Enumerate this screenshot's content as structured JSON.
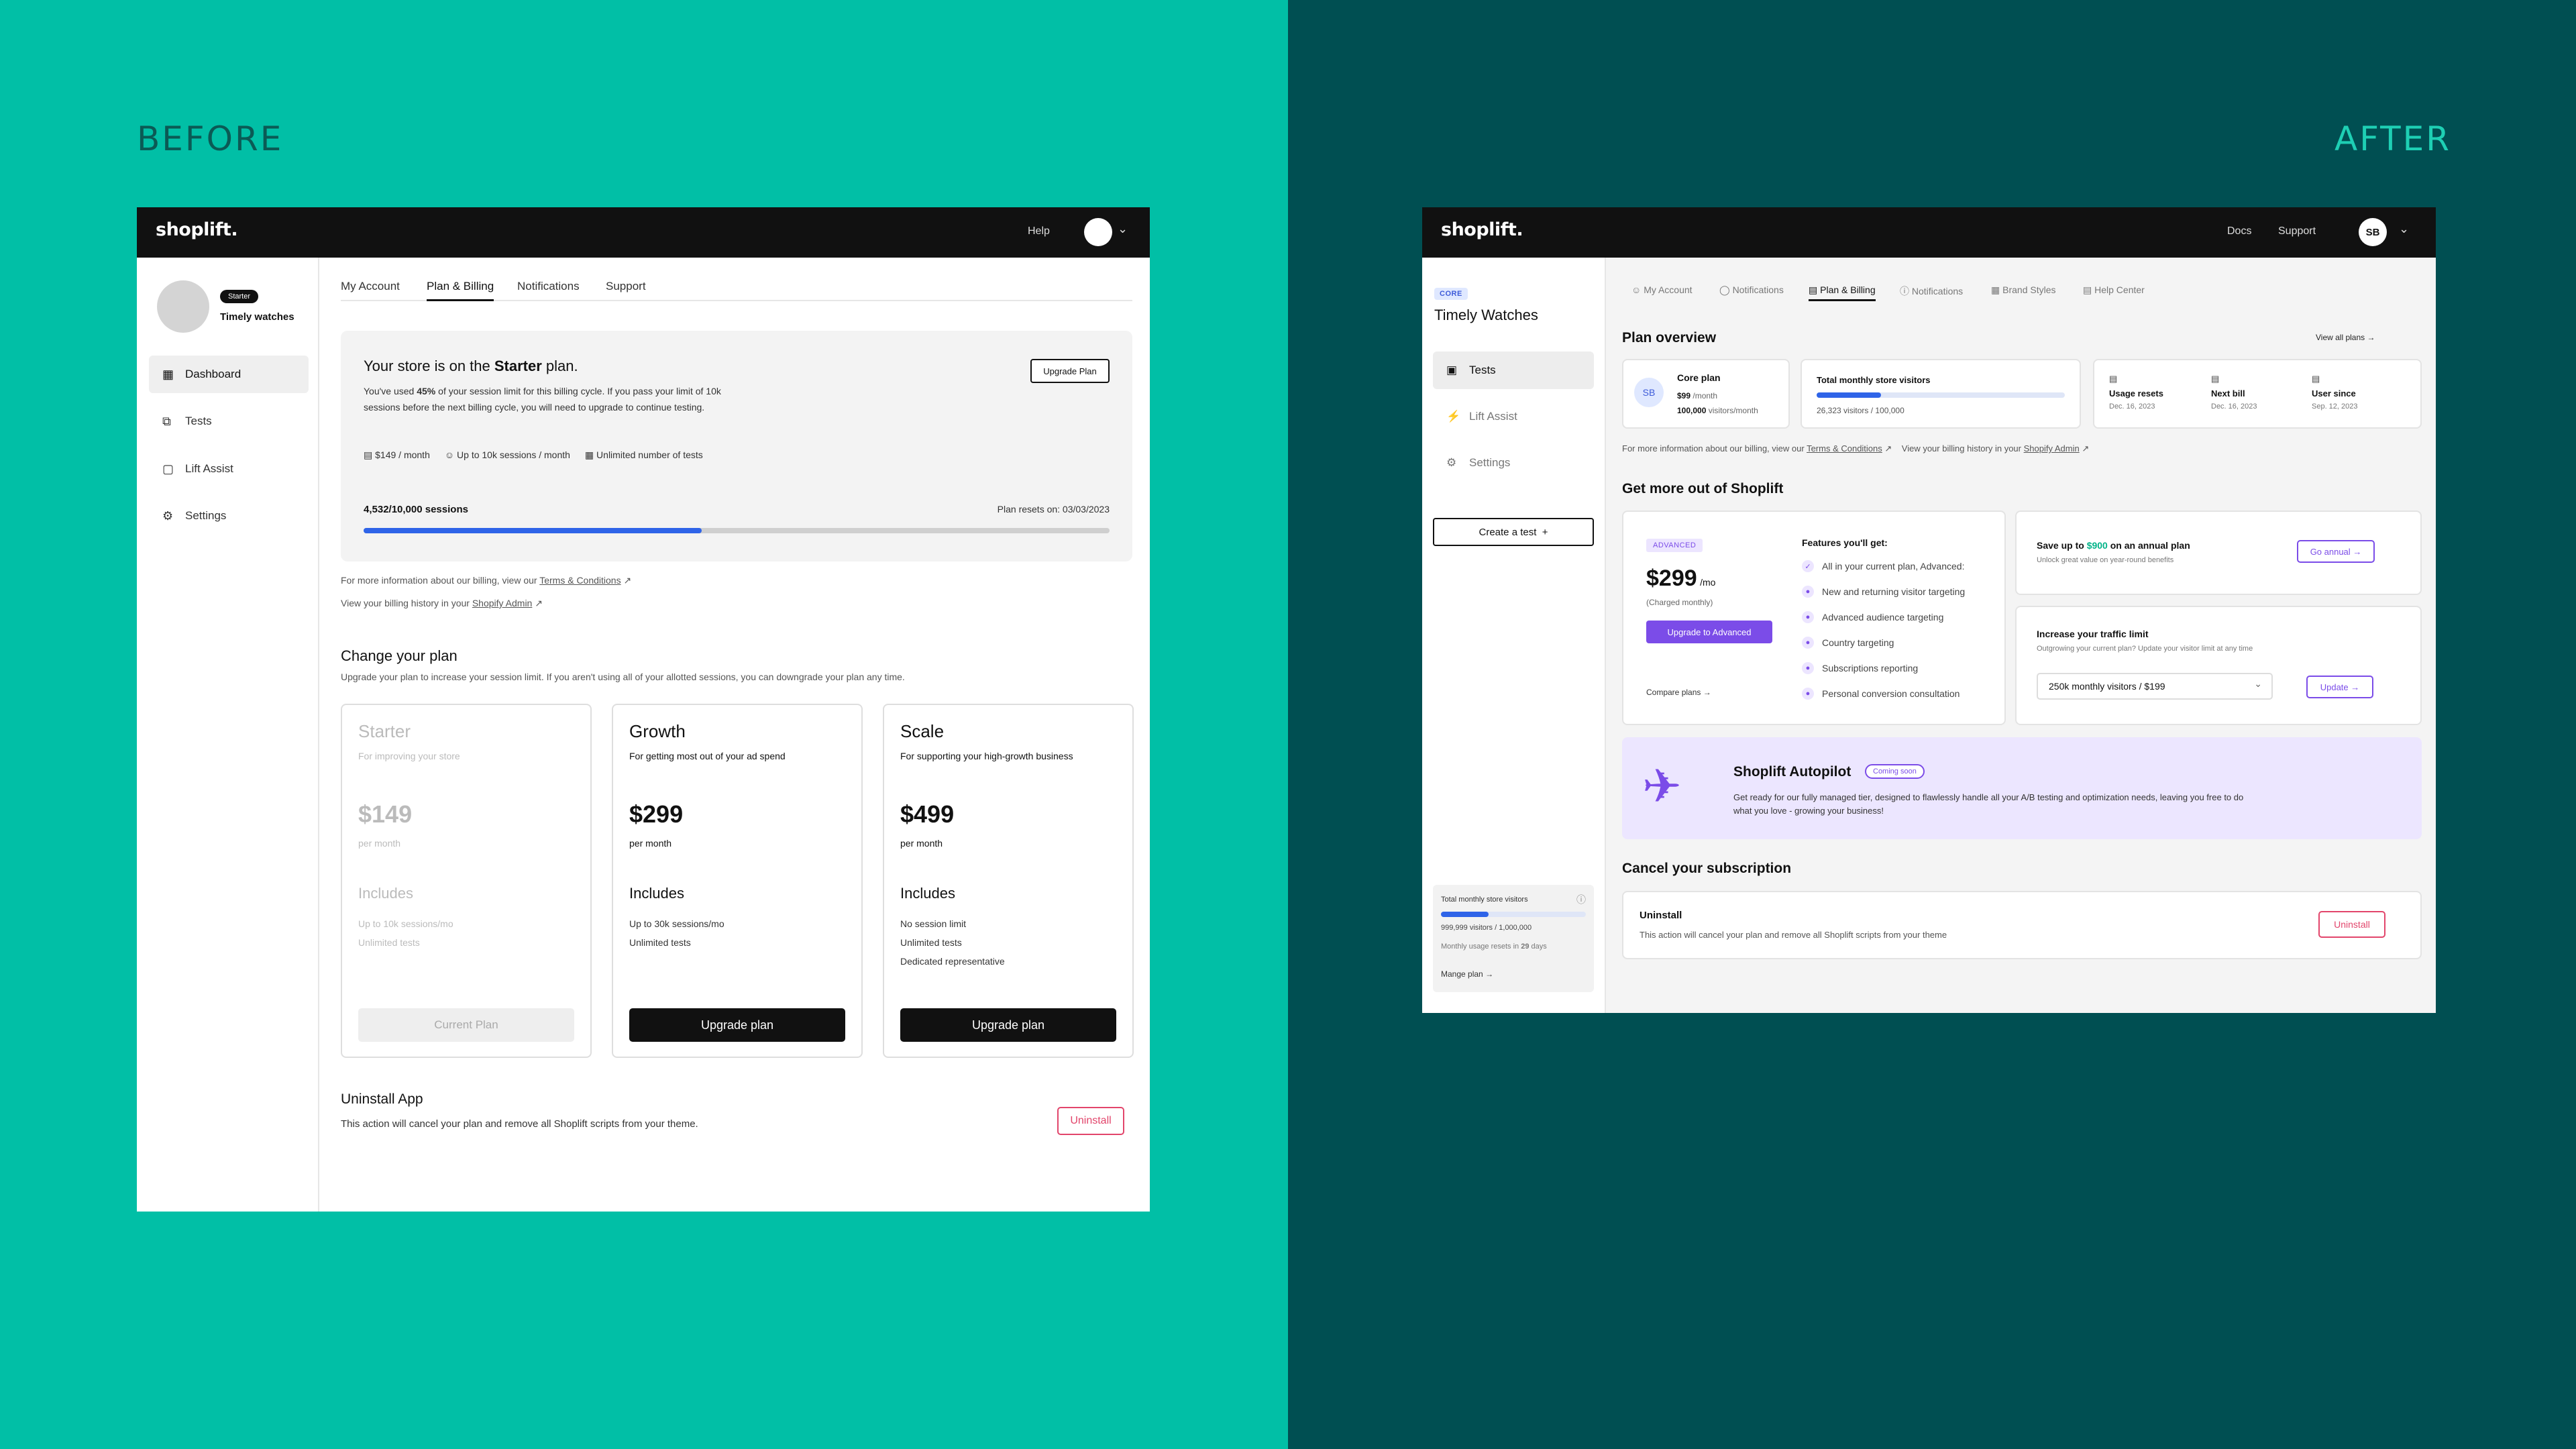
{
  "labels": {
    "before": "BEFORE",
    "after": "AFTER"
  },
  "colors": {
    "teal": "#01bfa6",
    "dark_teal": "#004f52",
    "purple": "#7b4ce8",
    "blue": "#2f64e8",
    "pink": "#e2456b"
  },
  "before": {
    "logo": "shoplift.",
    "top_help": "Help",
    "sidebar": {
      "badge": "Starter",
      "store_name": "Timely watches",
      "items": [
        {
          "label": "Dashboard",
          "icon": "dashboard-icon"
        },
        {
          "label": "Tests",
          "icon": "tests-icon"
        },
        {
          "label": "Lift Assist",
          "icon": "briefcase-icon"
        },
        {
          "label": "Settings",
          "icon": "gear-icon"
        }
      ]
    },
    "tabs": [
      "My Account",
      "Plan & Billing",
      "Notifications",
      "Support"
    ],
    "plan_box": {
      "title_pre": "Your store is on the ",
      "title_plan": "Starter",
      "title_post": " plan.",
      "desc_pre": "You've used ",
      "desc_pct": "45%",
      "desc_post": " of your session limit for this billing cycle. If you pass your limit of 10k sessions before the next billing cycle, you will need to upgrade to continue testing.",
      "upgrade_button": "Upgrade Plan",
      "meta": [
        "$149 / month",
        "Up to 10k sessions / month",
        "Unlimited number of tests"
      ],
      "sessions": "4,532/10,000 sessions",
      "resets": "Plan resets on: 03/03/2023",
      "progress": 0.4532
    },
    "billing_info_pre": "For more information about our billing, view our ",
    "billing_info_link": "Terms & Conditions",
    "billing_history_pre": "View your billing history in your ",
    "billing_history_link": "Shopify Admin",
    "change_plan": {
      "title": "Change your plan",
      "subtitle": "Upgrade your plan to increase your session limit. If you aren't using all of your allotted sessions, you can downgrade your plan any time.",
      "plans": [
        {
          "name": "Starter",
          "desc": "For improving your store",
          "price": "$149",
          "per": "per month",
          "includes": "Includes",
          "features": [
            "Up to 10k sessions/mo",
            "Unlimited tests"
          ],
          "button": "Current Plan"
        },
        {
          "name": "Growth",
          "desc": "For getting most out of your ad spend",
          "price": "$299",
          "per": "per month",
          "includes": "Includes",
          "features": [
            "Up to 30k sessions/mo",
            "Unlimited tests"
          ],
          "button": "Upgrade plan"
        },
        {
          "name": "Scale",
          "desc": "For supporting your high-growth business",
          "price": "$499",
          "per": "per month",
          "includes": "Includes",
          "features": [
            "No session limit",
            "Unlimited tests",
            "Dedicated representative"
          ],
          "button": "Upgrade plan"
        }
      ]
    },
    "uninstall": {
      "title": "Uninstall App",
      "desc": "This action will cancel your plan and remove all Shoplift scripts from your theme.",
      "button": "Uninstall"
    }
  },
  "after": {
    "logo": "shoplift.",
    "top_docs": "Docs",
    "top_support": "Support",
    "avatar": "SB",
    "sidebar": {
      "badge": "CORE",
      "store_name": "Timely Watches",
      "items": [
        {
          "label": "Tests",
          "icon": "tests-icon"
        },
        {
          "label": "Lift Assist",
          "icon": "bolt-icon"
        },
        {
          "label": "Settings",
          "icon": "gear-icon"
        }
      ],
      "create_button": "Create a test",
      "usage": {
        "title": "Total monthly store visitors",
        "value": "999,999 visitors / 1,000,000",
        "resets_pre": "Monthly usage resets in ",
        "resets_days": "29",
        "resets_post": " days",
        "link": "Mange plan",
        "progress": 0.33
      }
    },
    "tabs": [
      "My Account",
      "Notifications",
      "Plan & Billing",
      "Notifications",
      "Brand Styles",
      "Help Center"
    ],
    "plan_overview": {
      "title": "Plan overview",
      "view_all": "View all plans",
      "plan_avatar": "SB",
      "plan_name": "Core plan",
      "plan_price": "$99",
      "plan_price_unit": "/month",
      "plan_visitors": "100,000",
      "plan_visitors_unit": "visitors/month",
      "visitors_title": "Total monthly store visitors",
      "visitors_value": "26,323 visitors / 100,000",
      "visitors_progress": 0.26,
      "stats": [
        {
          "label": "Usage resets",
          "value": "Dec. 16, 2023"
        },
        {
          "label": "Next bill",
          "value": "Dec. 16, 2023"
        },
        {
          "label": "User since",
          "value": "Sep. 12, 2023"
        }
      ],
      "billing_info_pre": "For more information about our billing, view our ",
      "billing_info_link": "Terms & Conditions",
      "billing_history_pre": "View your billing history in your ",
      "billing_history_link": "Shopify Admin"
    },
    "get_more": {
      "title": "Get more out of Shoplift",
      "badge": "ADVANCED",
      "price": "$299",
      "price_unit": "/mo",
      "charged": "(Charged monthly)",
      "upgrade_button": "Upgrade to Advanced",
      "compare": "Compare plans",
      "features_title": "Features you'll get:",
      "features": [
        "All in your current plan, Advanced:",
        "New and returning visitor targeting",
        "Advanced audience targeting",
        "Country targeting",
        "Subscriptions reporting",
        "Personal conversion consultation"
      ],
      "annual": {
        "title_pre": "Save up to ",
        "title_amount": "$900",
        "title_post": " on an annual plan",
        "desc": "Unlock great value on year-round benefits",
        "button": "Go annual"
      },
      "traffic": {
        "title": "Increase your traffic limit",
        "desc": "Outgrowing your current plan? Update your visitor limit at any time",
        "select": "250k monthly visitors / $199",
        "button": "Update"
      }
    },
    "autopilot": {
      "title": "Shoplift Autopilot",
      "badge": "Coming soon",
      "desc": "Get ready for our fully managed tier, designed to flawlessly handle all your A/B testing and optimization needs, leaving you free to do what you love - growing your business!"
    },
    "cancel": {
      "title": "Cancel your subscription",
      "card_title": "Uninstall",
      "card_desc": "This action will cancel your plan and remove all Shoplift scripts from your theme",
      "button": "Uninstall"
    }
  }
}
